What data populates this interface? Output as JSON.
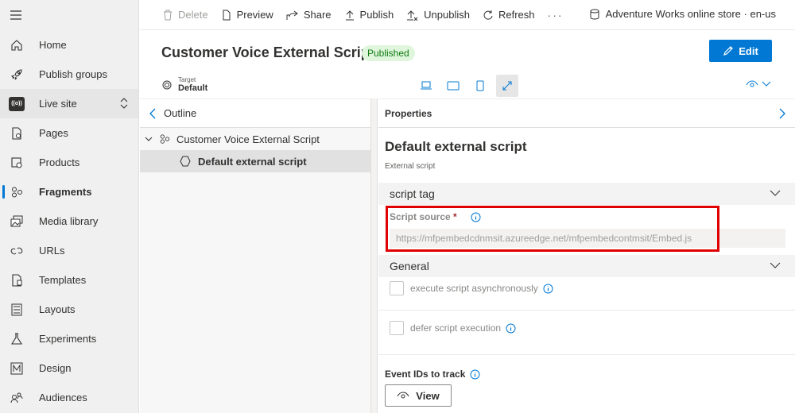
{
  "nav": {
    "items": [
      {
        "label": "Home",
        "icon": "home-icon"
      },
      {
        "label": "Publish groups",
        "icon": "rocket-icon"
      },
      {
        "label": "Live site",
        "icon": "live-site-icon",
        "badge_text": "((o))"
      },
      {
        "label": "Pages",
        "icon": "pages-icon"
      },
      {
        "label": "Products",
        "icon": "products-icon"
      },
      {
        "label": "Fragments",
        "icon": "fragments-icon",
        "active": true
      },
      {
        "label": "Media library",
        "icon": "media-library-icon"
      },
      {
        "label": "URLs",
        "icon": "link-icon"
      },
      {
        "label": "Templates",
        "icon": "templates-icon"
      },
      {
        "label": "Layouts",
        "icon": "layouts-icon"
      },
      {
        "label": "Experiments",
        "icon": "flask-icon"
      },
      {
        "label": "Design",
        "icon": "design-icon"
      },
      {
        "label": "Audiences",
        "icon": "audiences-icon"
      }
    ]
  },
  "toolbar": {
    "delete_label": "Delete",
    "preview_label": "Preview",
    "share_label": "Share",
    "publish_label": "Publish",
    "unpublish_label": "Unpublish",
    "refresh_label": "Refresh",
    "more_label": "···",
    "site_label": "Adventure Works online store · en-us"
  },
  "header": {
    "title": "Customer Voice External Script",
    "status": "Published",
    "edit_label": "Edit"
  },
  "target": {
    "caption": "Target",
    "value": "Default"
  },
  "outline": {
    "title": "Outline",
    "root": "Customer Voice External Script",
    "child": "Default external script"
  },
  "properties": {
    "header": "Properties",
    "title": "Default external script",
    "subtitle": "External script",
    "section_script": "script tag",
    "script_source_label": "Script source",
    "required_mark": "*",
    "script_source_value": "https://mfpembedcdnmsit.azureedge.net/mfpembedcontmsit/Embed.js",
    "section_general": "General",
    "async_label": "execute script asynchronously",
    "defer_label": "defer script execution",
    "event_ids_label": "Event IDs to track",
    "view_label": "View"
  },
  "colors": {
    "accent": "#0078d4",
    "published_bg": "#dff6dd",
    "published_text": "#107c10",
    "highlight": "#e00000"
  }
}
